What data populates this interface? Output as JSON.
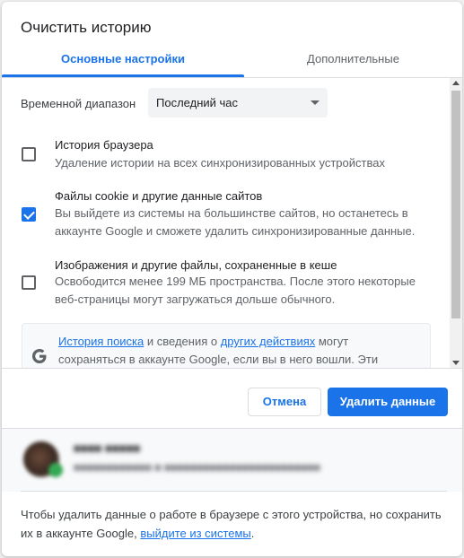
{
  "dialog": {
    "title": "Очистить историю"
  },
  "tabs": [
    {
      "label": "Основные настройки",
      "active": true
    },
    {
      "label": "Дополнительные",
      "active": false
    }
  ],
  "time_range": {
    "label": "Временной диапазон",
    "selected": "Последний час"
  },
  "items": [
    {
      "title": "История браузера",
      "desc": "Удаление истории на всех синхронизированных устройствах",
      "checked": false
    },
    {
      "title": "Файлы cookie и другие данные сайтов",
      "desc": "Вы выйдете из системы на большинстве сайтов, но останетесь в аккаунте Google и сможете удалить синхронизированные данные.",
      "checked": true
    },
    {
      "title": "Изображения и другие файлы, сохраненные в кеше",
      "desc": "Освободится менее 199 МБ пространства. После этого некоторые веб-страницы могут загружаться дольше обычного.",
      "checked": false
    }
  ],
  "info": {
    "link1": "История поиска",
    "text1": " и сведения о ",
    "link2": "других действиях",
    "text2": " могут сохраняться в аккаунте Google, если вы в него вошли. Эти"
  },
  "buttons": {
    "cancel": "Отмена",
    "delete": "Удалить данные"
  },
  "footer": {
    "text": "Чтобы удалить данные о работе в браузере с этого устройства, но сохранить их в аккаунте Google, ",
    "link": "выйдите из системы",
    "end": "."
  },
  "colors": {
    "accent": "#1a73e8",
    "text_primary": "#202124",
    "text_secondary": "#5f6368"
  }
}
